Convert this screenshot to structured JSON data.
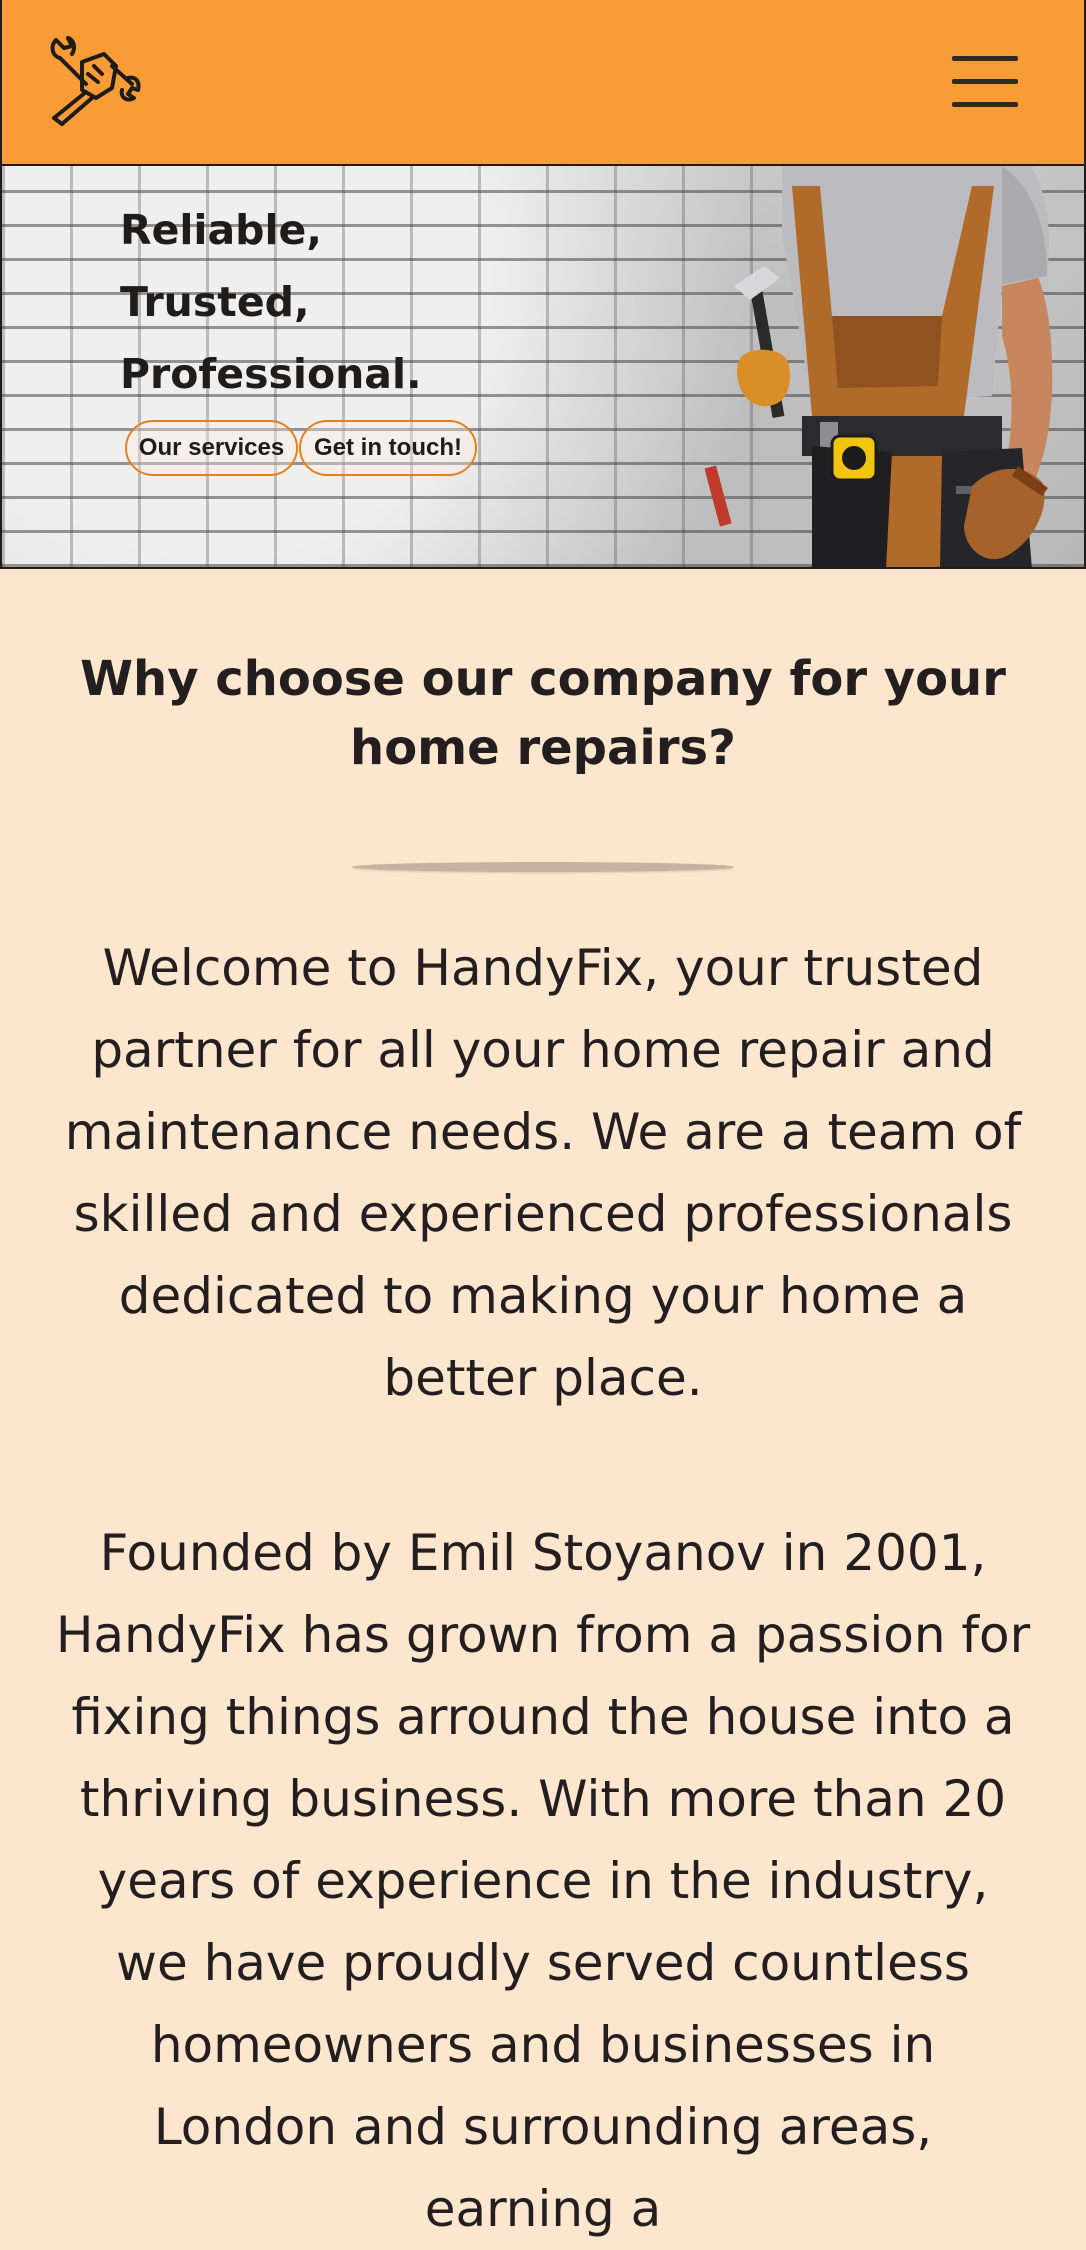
{
  "header": {
    "logo_icon": "handyman-logo-icon",
    "menu_icon": "hamburger-menu-icon",
    "background_color": "#f99b37"
  },
  "hero": {
    "heading_lines": [
      "Reliable,",
      "Trusted,",
      "Professional."
    ],
    "buttons": {
      "services_label": "Our services",
      "contact_label": "Get in touch!"
    },
    "button_border_color": "#e5801f",
    "image": "handyman-with-tools-image"
  },
  "main": {
    "title": "Why choose our company for your home repairs?",
    "paragraphs": [
      "Welcome to HandyFix, your trusted partner for all your home repair and maintenance needs. We are a team of skilled and experienced professionals dedicated to making your home a better place.",
      "Founded by Emil Stoyanov in 2001, HandyFix has grown from a passion for fixing things arround the house into a thriving business. With more than 20 years of experience in the industry, we have proudly served countless homeowners and businesses in London and surrounding areas, earning a"
    ],
    "background_color": "#fce6ce"
  }
}
